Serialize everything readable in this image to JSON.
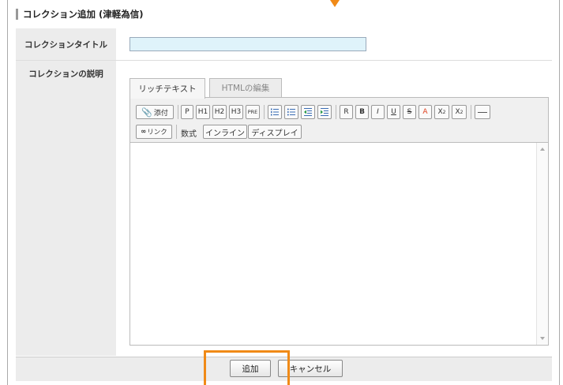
{
  "header": {
    "title": "コレクション追加 (津軽為信)"
  },
  "form": {
    "title_label": "コレクションタイトル",
    "title_value": "",
    "description_label": "コレクションの説明"
  },
  "editor": {
    "tabs": [
      {
        "label": "リッチテキスト",
        "active": true
      },
      {
        "label": "HTMLの編集",
        "active": false
      }
    ],
    "toolbar": {
      "attach": "添付",
      "p": "P",
      "h1": "H1",
      "h2": "H2",
      "h3": "H3",
      "pre": "PRE",
      "bold_r": "R",
      "bold_b": "B",
      "italic": "I",
      "underline": "U",
      "strike": "S",
      "color": "A",
      "sup": "X",
      "sub": "X",
      "link": "リンク",
      "math_label": "数式",
      "inline": "インライン",
      "display": "ディスプレイ"
    },
    "content": ""
  },
  "buttons": {
    "add": "追加",
    "cancel": "キャンセル"
  },
  "colors": {
    "highlight": "#f08a17",
    "input_bg": "#dff3fa",
    "label_bg": "#ececec"
  }
}
